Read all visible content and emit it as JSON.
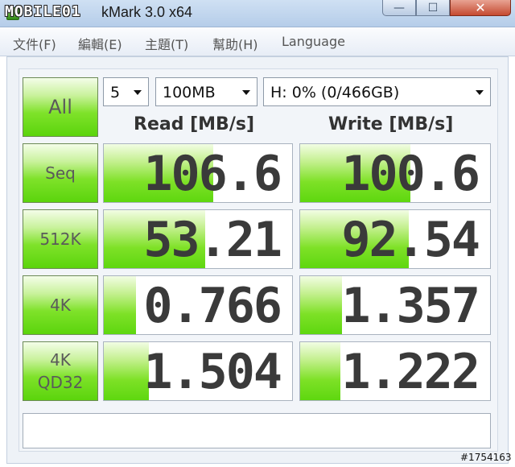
{
  "window": {
    "watermark": "MOBILE01",
    "title": "kMark 3.0 x64",
    "minimize_glyph": "—",
    "maximize_glyph": "☐",
    "close_glyph": "✕"
  },
  "menu": {
    "items": [
      "文件(F)",
      "編輯(E)",
      "主題(T)",
      "幫助(H)",
      "Language"
    ]
  },
  "controls": {
    "all_label": "All",
    "count": "5",
    "size": "100MB",
    "drive": "H: 0% (0/466GB)"
  },
  "headers": {
    "read": "Read [MB/s]",
    "write": "Write [MB/s]"
  },
  "tests": [
    {
      "label": "Seq",
      "read": "106.6",
      "write": "100.6",
      "read_fill": 0.58,
      "write_fill": 0.58
    },
    {
      "label": "512K",
      "read": "53.21",
      "write": "92.54",
      "read_fill": 0.54,
      "write_fill": 0.57
    },
    {
      "label": "4K",
      "read": "0.766",
      "write": "1.357",
      "read_fill": 0.17,
      "write_fill": 0.22
    },
    {
      "label": "4K\nQD32",
      "read": "1.504",
      "write": "1.222",
      "read_fill": 0.24,
      "write_fill": 0.21
    }
  ],
  "status": "",
  "badge": "#1754163",
  "colors": {
    "accent_green": "#5bd40c",
    "title_bar": "#b5cde9",
    "close_red": "#c54a30"
  }
}
